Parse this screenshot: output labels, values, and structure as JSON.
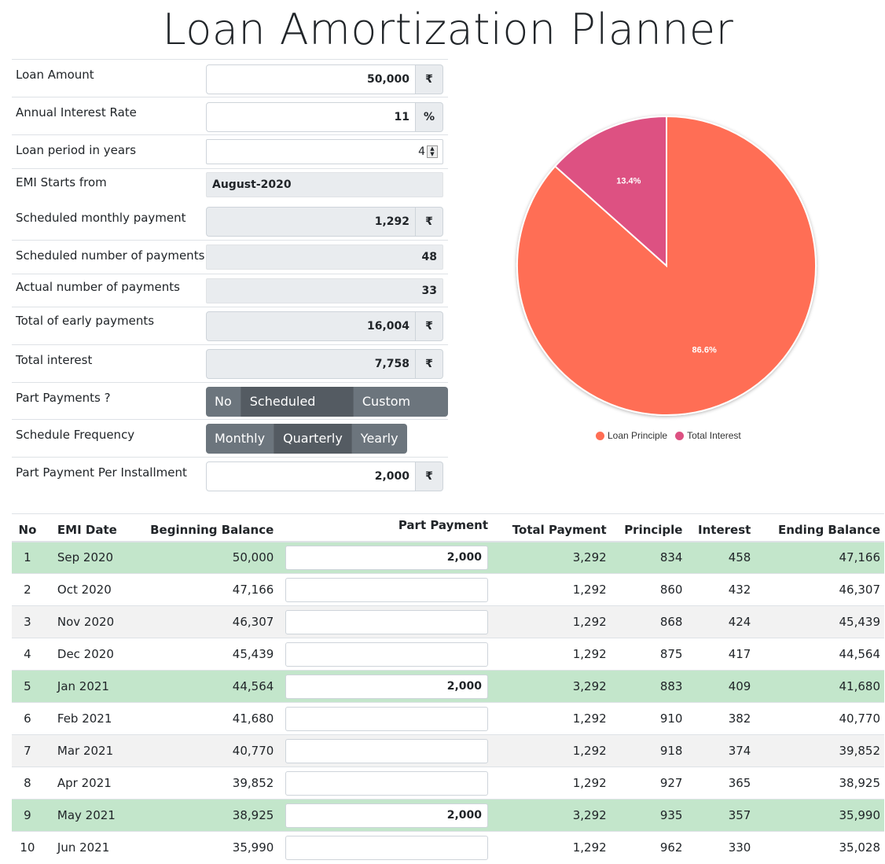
{
  "page_title": "Loan Amortization Planner",
  "form": {
    "loan_amount": {
      "label": "Loan Amount",
      "value": "50,000",
      "unit": "₹"
    },
    "interest_rate": {
      "label": "Annual Interest Rate",
      "value": "11",
      "unit": "%"
    },
    "loan_period": {
      "label": "Loan period in years",
      "value": "4"
    },
    "emi_start": {
      "label": "EMI Starts from",
      "value": "August-2020"
    },
    "monthly_payment": {
      "label": "Scheduled monthly payment",
      "value": "1,292",
      "unit": "₹"
    },
    "scheduled_payments": {
      "label": "Scheduled number of payments",
      "value": "48"
    },
    "actual_payments": {
      "label": "Actual number of payments",
      "value": "33"
    },
    "early_payments": {
      "label": "Total of early payments",
      "value": "16,004",
      "unit": "₹"
    },
    "total_interest": {
      "label": "Total interest",
      "value": "7,758",
      "unit": "₹"
    },
    "part_payments": {
      "label": "Part Payments ?",
      "options": [
        "No",
        "Scheduled Plan",
        "Custom Plan"
      ],
      "selected": "Scheduled Plan"
    },
    "schedule_frequency": {
      "label": "Schedule Frequency",
      "options": [
        "Monthly",
        "Quarterly",
        "Yearly"
      ],
      "selected": "Quarterly"
    },
    "part_payment_installment": {
      "label": "Part Payment Per Installment",
      "value": "2,000",
      "unit": "₹"
    }
  },
  "chart_data": {
    "type": "pie",
    "categories": [
      "Loan Principle",
      "Total Interest"
    ],
    "values": [
      86.6,
      13.4
    ],
    "labels": [
      "86.6%",
      "13.4%"
    ],
    "colors": [
      "#ff6e54",
      "#dd5182"
    ],
    "legend": "bottom"
  },
  "table": {
    "headers": [
      "No",
      "EMI Date",
      "Beginning Balance",
      "Part Payment",
      "Total Payment",
      "Principle",
      "Interest",
      "Ending Balance"
    ],
    "rows": [
      {
        "no": "1",
        "date": "Sep 2020",
        "begin": "50,000",
        "part": "2,000",
        "total": "3,292",
        "principle": "834",
        "interest": "458",
        "end": "47,166"
      },
      {
        "no": "2",
        "date": "Oct 2020",
        "begin": "47,166",
        "part": "",
        "total": "1,292",
        "principle": "860",
        "interest": "432",
        "end": "46,307"
      },
      {
        "no": "3",
        "date": "Nov 2020",
        "begin": "46,307",
        "part": "",
        "total": "1,292",
        "principle": "868",
        "interest": "424",
        "end": "45,439"
      },
      {
        "no": "4",
        "date": "Dec 2020",
        "begin": "45,439",
        "part": "",
        "total": "1,292",
        "principle": "875",
        "interest": "417",
        "end": "44,564"
      },
      {
        "no": "5",
        "date": "Jan 2021",
        "begin": "44,564",
        "part": "2,000",
        "total": "3,292",
        "principle": "883",
        "interest": "409",
        "end": "41,680"
      },
      {
        "no": "6",
        "date": "Feb 2021",
        "begin": "41,680",
        "part": "",
        "total": "1,292",
        "principle": "910",
        "interest": "382",
        "end": "40,770"
      },
      {
        "no": "7",
        "date": "Mar 2021",
        "begin": "40,770",
        "part": "",
        "total": "1,292",
        "principle": "918",
        "interest": "374",
        "end": "39,852"
      },
      {
        "no": "8",
        "date": "Apr 2021",
        "begin": "39,852",
        "part": "",
        "total": "1,292",
        "principle": "927",
        "interest": "365",
        "end": "38,925"
      },
      {
        "no": "9",
        "date": "May 2021",
        "begin": "38,925",
        "part": "2,000",
        "total": "3,292",
        "principle": "935",
        "interest": "357",
        "end": "35,990"
      },
      {
        "no": "10",
        "date": "Jun 2021",
        "begin": "35,990",
        "part": "",
        "total": "1,292",
        "principle": "962",
        "interest": "330",
        "end": "35,028"
      }
    ]
  }
}
